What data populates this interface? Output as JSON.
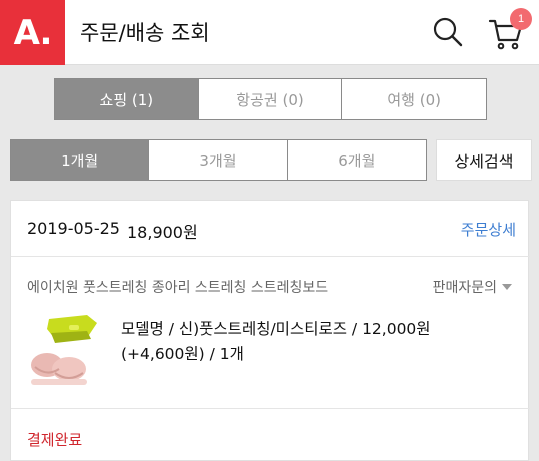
{
  "header": {
    "logo": "A.",
    "title": "주문/배송 조회",
    "search_icon": "search-icon",
    "cart_icon": "cart-icon",
    "cart_count": "1",
    "brand_color": "#e8303a"
  },
  "category_tabs": [
    {
      "label": "쇼핑 (1)",
      "active": true
    },
    {
      "label": "항공권 (0)",
      "active": false
    },
    {
      "label": "여행 (0)",
      "active": false
    }
  ],
  "period_tabs": [
    {
      "label": "1개월",
      "active": true
    },
    {
      "label": "3개월",
      "active": false
    },
    {
      "label": "6개월",
      "active": false
    }
  ],
  "detail_search_label": "상세검색",
  "order": {
    "date": "2019-05-25",
    "total": "18,900원",
    "detail_link": "주문상세",
    "product_name": "에이치원 풋스트레칭 종아리 스트레칭 스트레칭보드",
    "seller_inquiry": "판매자문의",
    "option_line1": "모델명 / 신)풋스트레칭/미스티로즈 / 12,000원",
    "option_line2": "(+4,600원) / 1개",
    "status": "결제완료",
    "status_color": "#d0272e",
    "link_color": "#3e7ed1"
  }
}
